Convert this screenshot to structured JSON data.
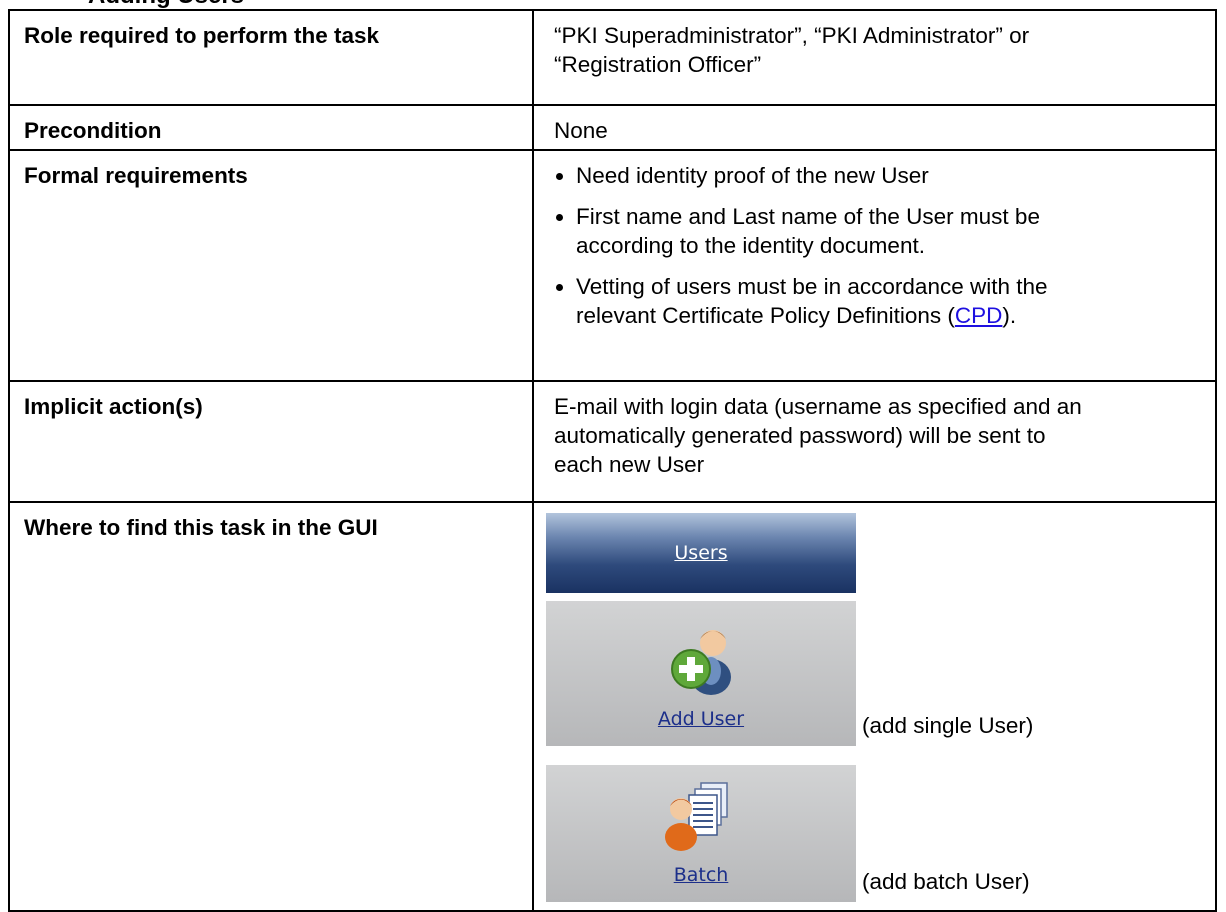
{
  "heading_fragment": "Adding Users",
  "rows": {
    "role": {
      "label": "Role required to perform the task",
      "value_line1": "“PKI Superadministrator”, “PKI Administrator” or",
      "value_line2": "“Registration Officer”"
    },
    "precondition": {
      "label": "Precondition",
      "value": "None"
    },
    "formal": {
      "label": "Formal requirements",
      "bullet1": "Need identity proof of the new User",
      "bullet2_line1": "First name and Last name of the User must be",
      "bullet2_line2": "according to the identity document.",
      "bullet3_line1": "Vetting of users must be in accordance with the",
      "bullet3_line2_pre": "relevant Certificate Policy Definitions (",
      "bullet3_link": "CPD",
      "bullet3_line2_post": ")."
    },
    "implicit": {
      "label": "Implicit action(s)",
      "value_line1": "E-mail with login data (username as specified and an",
      "value_line2": "automatically generated password) will be sent to",
      "value_line3": "each new User"
    },
    "gui": {
      "label": "Where to find this task in the GUI",
      "users_button": "Users",
      "add_user_button": "Add User",
      "add_user_note": "(add single User)",
      "batch_button": "Batch",
      "batch_note": "(add batch User)"
    }
  },
  "colors": {
    "link": "#1e10e0",
    "users_button_dark": "#1a3262",
    "users_button_light": "#b2c4dc",
    "icon_button_bg": "#c6c7c9",
    "icon_caption": "#1c2f8a",
    "add_icon_green": "#5fa83a",
    "user_icon_blue": "#2f4f80",
    "batch_icon_orange": "#e06a1a"
  },
  "icons": [
    "add-user-icon",
    "batch-icon"
  ]
}
